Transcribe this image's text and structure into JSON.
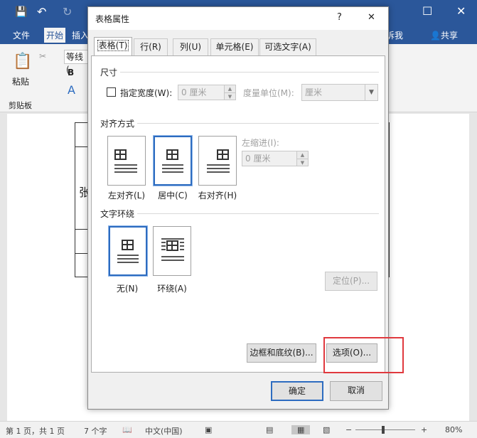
{
  "app": {
    "tabs": [
      "文件",
      "开始",
      "插入"
    ],
    "right_tabs": [
      "诉我",
      "共享"
    ],
    "paste_label": "粘贴",
    "font_name": "等线 (",
    "clipboard_label": "剪贴板",
    "doc_text": "张"
  },
  "status": {
    "page": "第 1 页，共 1 页",
    "words": "7 个字",
    "lang": "中文(中国)",
    "zoom": "80%"
  },
  "dialog": {
    "title": "表格属性",
    "help": "?",
    "close": "✕",
    "tabs": [
      "表格(T)",
      "行(R)",
      "列(U)",
      "单元格(E)",
      "可选文字(A)"
    ],
    "size": {
      "header": "尺寸",
      "pref_width_label": "指定宽度(W):",
      "width_value": "0 厘米",
      "unit_label": "度量单位(M):",
      "unit_value": "厘米"
    },
    "alignment": {
      "header": "对齐方式",
      "options": [
        "左对齐(L)",
        "居中(C)",
        "右对齐(H)"
      ],
      "indent_label": "左缩进(I):",
      "indent_value": "0 厘米"
    },
    "wrapping": {
      "header": "文字环绕",
      "options": [
        "无(N)",
        "环绕(A)"
      ],
      "position_button": "定位(P)..."
    },
    "borders_button": "边框和底纹(B)...",
    "options_button": "选项(O)...",
    "ok_button": "确定",
    "cancel_button": "取消"
  },
  "colors": {
    "accent": "#2b579a",
    "highlight": "#e0393e",
    "select": "#2d6cc0"
  }
}
